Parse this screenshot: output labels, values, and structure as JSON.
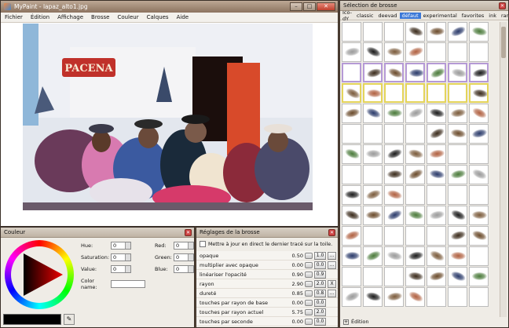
{
  "main_window": {
    "title": "MyPaint - lapaz_alto1.jpg",
    "menu": [
      "Fichier",
      "Édition",
      "Affichage",
      "Brosse",
      "Couleur",
      "Calques",
      "Aide"
    ]
  },
  "painting": {
    "sign_text": "PACENA",
    "colors": {
      "wall": "#e8eaf0",
      "door": "#d84a2a",
      "sign": "#c0312a"
    }
  },
  "color_panel": {
    "title": "Couleur",
    "fields": {
      "hue_label": "Hue:",
      "hue_value": "0",
      "saturation_label": "Saturation:",
      "saturation_value": "0",
      "value_label": "Value:",
      "value_value": "0",
      "red_label": "Red:",
      "red_value": "0",
      "green_label": "Green:",
      "green_value": "0",
      "blue_label": "Blue:",
      "blue_value": "0",
      "color_name_label": "Color name:",
      "color_name_value": ""
    },
    "current_color": "#000000"
  },
  "brush_settings": {
    "title": "Réglages de la brosse",
    "live_update_label": "Mettre à jour en direct le dernier tracé sur la toile.",
    "rows": [
      {
        "label": "opaque",
        "value": "0.50",
        "btn": "1.0",
        "btn2": "..."
      },
      {
        "label": "multiplier avec opaque",
        "value": "0.00",
        "btn": "0.0",
        "btn2": "..."
      },
      {
        "label": "linéariser l'opacité",
        "value": "0.90",
        "btn": "0.9",
        "btn2": ""
      },
      {
        "label": "rayon",
        "value": "2.90",
        "btn": "2.0",
        "btn2": "X"
      },
      {
        "label": "dureté",
        "value": "0.85",
        "btn": "0.8",
        "btn2": "..."
      },
      {
        "label": "touches par rayon de base",
        "value": "0.00",
        "btn": "0.0",
        "btn2": ""
      },
      {
        "label": "touches par rayon actuel",
        "value": "5.75",
        "btn": "2.0",
        "btn2": ""
      },
      {
        "label": "touches par seconde",
        "value": "0.00",
        "btn": "0.0",
        "btn2": ""
      }
    ]
  },
  "brush_selection": {
    "title": "Sélection de brosse",
    "tabs": [
      "Ico-dY",
      "classic",
      "deevad",
      "défaut",
      "experimental",
      "favorites",
      "ink",
      "ramòn",
      "tanda"
    ],
    "active_tab": "défaut",
    "footer": "Édition"
  }
}
